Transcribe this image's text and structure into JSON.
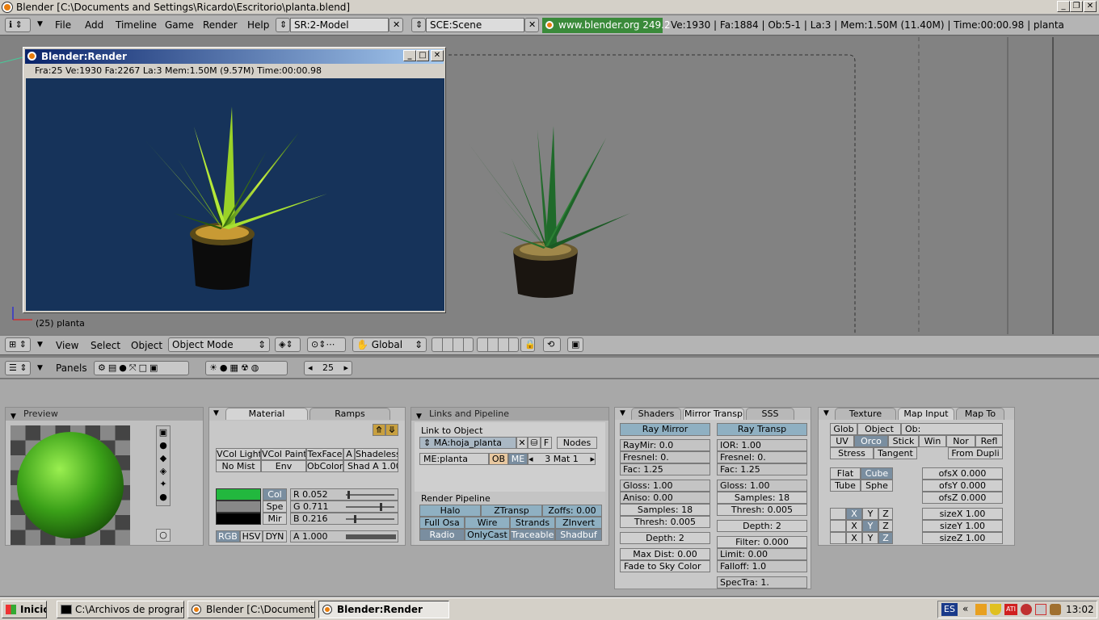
{
  "window": {
    "title": "Blender [C:\\Documents and Settings\\Ricardo\\Escritorio\\planta.blend]"
  },
  "topbar": {
    "menus": [
      "File",
      "Add",
      "Timeline",
      "Game",
      "Render",
      "Help"
    ],
    "screen": "SR:2-Model",
    "scene": "SCE:Scene",
    "url": "www.blender.org 249.2",
    "stats": "Ve:1930 | Fa:1884 | Ob:5-1 | La:3  | Mem:1.50M (11.40M) | Time:00:00.98 | planta"
  },
  "render_window": {
    "title": "Blender:Render",
    "info": "Fra:25  Ve:1930 Fa:2267 La:3 Mem:1.50M (9.57M) Time:00:00.98"
  },
  "viewport": {
    "frame_label": "(25) planta"
  },
  "view3d_header": {
    "menus": [
      "View",
      "Select",
      "Object"
    ],
    "mode": "Object Mode",
    "orientation": "Global"
  },
  "buttons_header": {
    "panels_label": "Panels",
    "frame": "25"
  },
  "preview": {
    "title": "Preview"
  },
  "material": {
    "tabs": [
      "Material",
      "Ramps"
    ],
    "row1": [
      "VCol Light",
      "VCol Paint",
      "TexFace",
      "A",
      "Shadeless"
    ],
    "row2": [
      "No Mist",
      "Env",
      "ObColor",
      "Shad A 1.00"
    ],
    "col_buttons": [
      "Col",
      "Spe",
      "Mir"
    ],
    "rgb": [
      "R 0.052",
      "G 0.711",
      "B 0.216"
    ],
    "modes": [
      "RGB",
      "HSV",
      "DYN"
    ],
    "alpha": "A 1.000",
    "colors": {
      "col": "#22b83e",
      "spe": "#888888",
      "mir": "#000000"
    }
  },
  "links": {
    "title": "Links and Pipeline",
    "link_label": "Link to Object",
    "ma": "MA:hoja_planta",
    "f": "F",
    "nodes": "Nodes",
    "me": "ME:planta",
    "ob": "OB",
    "me_btn": "ME",
    "mat": "3 Mat 1",
    "pipeline_label": "Render Pipeline",
    "row1": [
      "Halo",
      "ZTransp",
      "Zoffs: 0.00"
    ],
    "row2": [
      "Full Osa",
      "Wire",
      "Strands",
      "ZInvert"
    ],
    "row3": [
      "Radio",
      "OnlyCast",
      "Traceable",
      "Shadbuf"
    ]
  },
  "mirror": {
    "tabs": [
      "Shaders",
      "Mirror Transp",
      "SSS"
    ],
    "raymirror": "Ray Mirror",
    "raytransp": "Ray Transp",
    "left": [
      "RayMir: 0.0",
      "Fresnel: 0.",
      "Fac: 1.25",
      "Gloss: 1.00",
      "Aniso: 0.00",
      "Samples: 18",
      "Thresh: 0.005",
      "Depth: 2",
      "Max Dist: 0.00",
      "Fade to Sky Color"
    ],
    "right": [
      "IOR: 1.00",
      "Fresnel: 0.",
      "Fac: 1.25",
      "Gloss: 1.00",
      "Samples: 18",
      "Thresh: 0.005",
      "Depth: 2",
      "Filter: 0.000",
      "Limit: 0.00",
      "Falloff: 1.0",
      "SpecTra: 1."
    ]
  },
  "mapinput": {
    "tabs": [
      "Texture",
      "Map Input",
      "Map To"
    ],
    "row1": [
      "Glob",
      "Object",
      "Ob:"
    ],
    "row2": [
      "UV",
      "Orco",
      "Stick",
      "Win",
      "Nor",
      "Refl"
    ],
    "row3": [
      "Stress",
      "Tangent",
      "From Dupli"
    ],
    "shape1": [
      "Flat",
      "Cube"
    ],
    "shape2": [
      "Tube",
      "Sphe"
    ],
    "ofs": [
      "ofsX 0.000",
      "ofsY 0.000",
      "ofsZ 0.000"
    ],
    "xyz": [
      "X",
      "Y",
      "Z"
    ],
    "size": [
      "sizeX 1.00",
      "sizeY 1.00",
      "sizeZ 1.00"
    ]
  },
  "taskbar": {
    "start": "Inicio",
    "items": [
      "C:\\Archivos de programa...",
      "Blender [C:\\Documents a...",
      "Blender:Render"
    ],
    "lang": "ES",
    "clock": "13:02"
  }
}
